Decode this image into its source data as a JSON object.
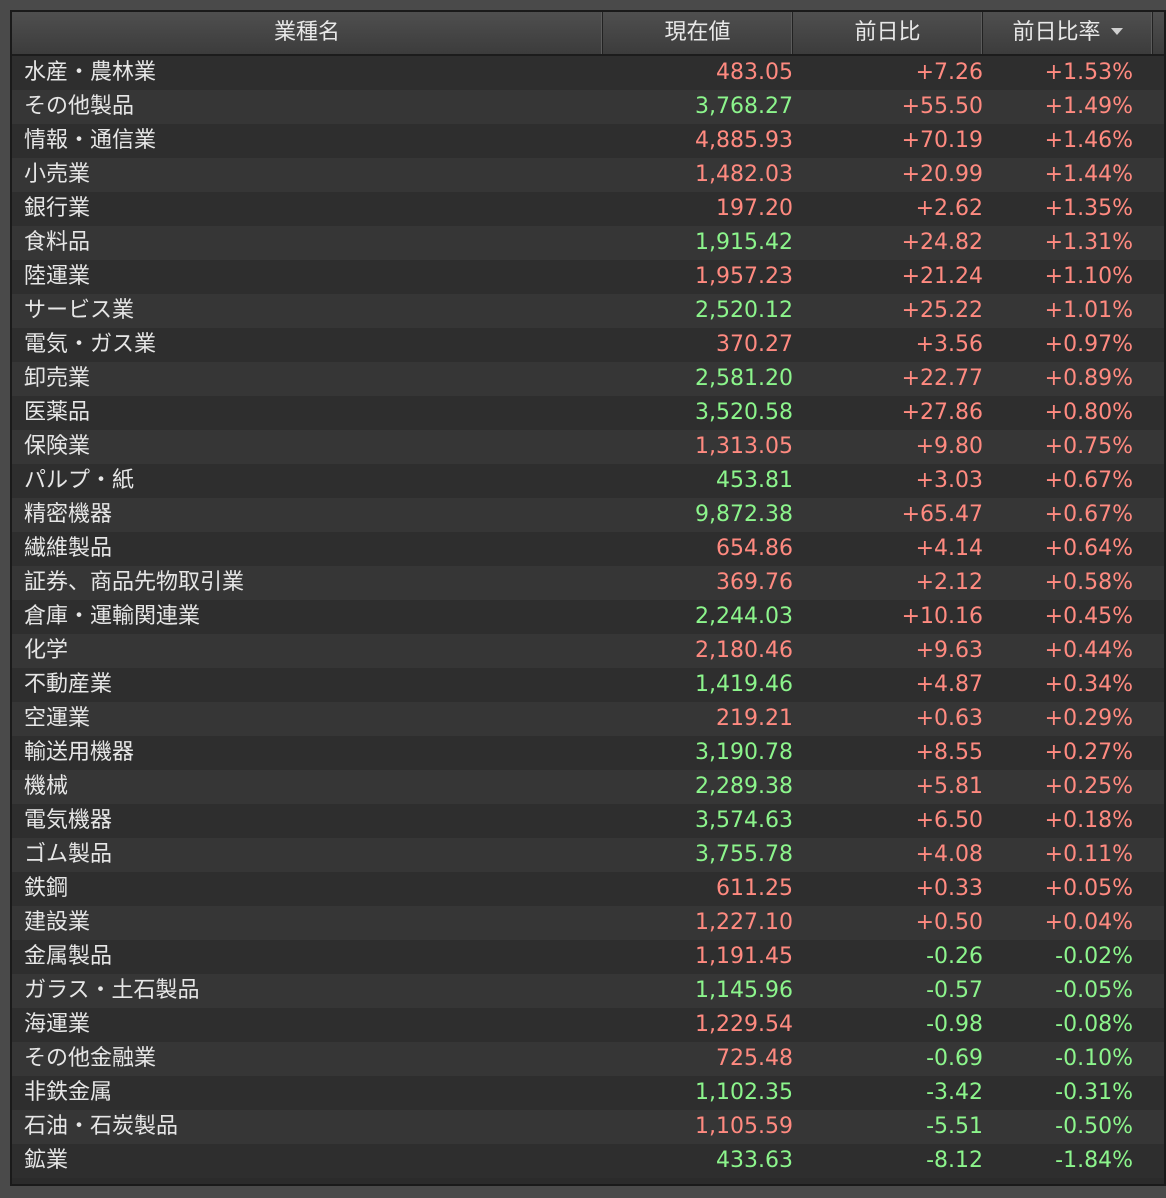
{
  "header": {
    "name": "業種名",
    "price": "現在値",
    "change": "前日比",
    "change_pct": "前日比率"
  },
  "colors": {
    "red": "#ff8a80",
    "green": "#8cf58c"
  },
  "rows": [
    {
      "name": "水産・農林業",
      "price": "483.05",
      "price_color": "red",
      "change": "+7.26",
      "pct": "+1.53%"
    },
    {
      "name": "その他製品",
      "price": "3,768.27",
      "price_color": "green",
      "change": "+55.50",
      "pct": "+1.49%"
    },
    {
      "name": "情報・通信業",
      "price": "4,885.93",
      "price_color": "red",
      "change": "+70.19",
      "pct": "+1.46%"
    },
    {
      "name": "小売業",
      "price": "1,482.03",
      "price_color": "red",
      "change": "+20.99",
      "pct": "+1.44%"
    },
    {
      "name": "銀行業",
      "price": "197.20",
      "price_color": "red",
      "change": "+2.62",
      "pct": "+1.35%"
    },
    {
      "name": "食料品",
      "price": "1,915.42",
      "price_color": "green",
      "change": "+24.82",
      "pct": "+1.31%"
    },
    {
      "name": "陸運業",
      "price": "1,957.23",
      "price_color": "red",
      "change": "+21.24",
      "pct": "+1.10%"
    },
    {
      "name": "サービス業",
      "price": "2,520.12",
      "price_color": "green",
      "change": "+25.22",
      "pct": "+1.01%"
    },
    {
      "name": "電気・ガス業",
      "price": "370.27",
      "price_color": "red",
      "change": "+3.56",
      "pct": "+0.97%"
    },
    {
      "name": "卸売業",
      "price": "2,581.20",
      "price_color": "green",
      "change": "+22.77",
      "pct": "+0.89%"
    },
    {
      "name": "医薬品",
      "price": "3,520.58",
      "price_color": "green",
      "change": "+27.86",
      "pct": "+0.80%"
    },
    {
      "name": "保険業",
      "price": "1,313.05",
      "price_color": "red",
      "change": "+9.80",
      "pct": "+0.75%"
    },
    {
      "name": "パルプ・紙",
      "price": "453.81",
      "price_color": "green",
      "change": "+3.03",
      "pct": "+0.67%"
    },
    {
      "name": "精密機器",
      "price": "9,872.38",
      "price_color": "green",
      "change": "+65.47",
      "pct": "+0.67%"
    },
    {
      "name": "繊維製品",
      "price": "654.86",
      "price_color": "red",
      "change": "+4.14",
      "pct": "+0.64%"
    },
    {
      "name": "証券、商品先物取引業",
      "price": "369.76",
      "price_color": "red",
      "change": "+2.12",
      "pct": "+0.58%"
    },
    {
      "name": "倉庫・運輸関連業",
      "price": "2,244.03",
      "price_color": "green",
      "change": "+10.16",
      "pct": "+0.45%"
    },
    {
      "name": "化学",
      "price": "2,180.46",
      "price_color": "red",
      "change": "+9.63",
      "pct": "+0.44%"
    },
    {
      "name": "不動産業",
      "price": "1,419.46",
      "price_color": "green",
      "change": "+4.87",
      "pct": "+0.34%"
    },
    {
      "name": "空運業",
      "price": "219.21",
      "price_color": "red",
      "change": "+0.63",
      "pct": "+0.29%"
    },
    {
      "name": "輸送用機器",
      "price": "3,190.78",
      "price_color": "green",
      "change": "+8.55",
      "pct": "+0.27%"
    },
    {
      "name": "機械",
      "price": "2,289.38",
      "price_color": "green",
      "change": "+5.81",
      "pct": "+0.25%"
    },
    {
      "name": "電気機器",
      "price": "3,574.63",
      "price_color": "green",
      "change": "+6.50",
      "pct": "+0.18%"
    },
    {
      "name": "ゴム製品",
      "price": "3,755.78",
      "price_color": "green",
      "change": "+4.08",
      "pct": "+0.11%"
    },
    {
      "name": "鉄鋼",
      "price": "611.25",
      "price_color": "red",
      "change": "+0.33",
      "pct": "+0.05%"
    },
    {
      "name": "建設業",
      "price": "1,227.10",
      "price_color": "red",
      "change": "+0.50",
      "pct": "+0.04%"
    },
    {
      "name": "金属製品",
      "price": "1,191.45",
      "price_color": "red",
      "change": "-0.26",
      "pct": "-0.02%"
    },
    {
      "name": "ガラス・土石製品",
      "price": "1,145.96",
      "price_color": "green",
      "change": "-0.57",
      "pct": "-0.05%"
    },
    {
      "name": "海運業",
      "price": "1,229.54",
      "price_color": "red",
      "change": "-0.98",
      "pct": "-0.08%"
    },
    {
      "name": "その他金融業",
      "price": "725.48",
      "price_color": "red",
      "change": "-0.69",
      "pct": "-0.10%"
    },
    {
      "name": "非鉄金属",
      "price": "1,102.35",
      "price_color": "green",
      "change": "-3.42",
      "pct": "-0.31%"
    },
    {
      "name": "石油・石炭製品",
      "price": "1,105.59",
      "price_color": "red",
      "change": "-5.51",
      "pct": "-0.50%"
    },
    {
      "name": "鉱業",
      "price": "433.63",
      "price_color": "green",
      "change": "-8.12",
      "pct": "-1.84%"
    }
  ]
}
